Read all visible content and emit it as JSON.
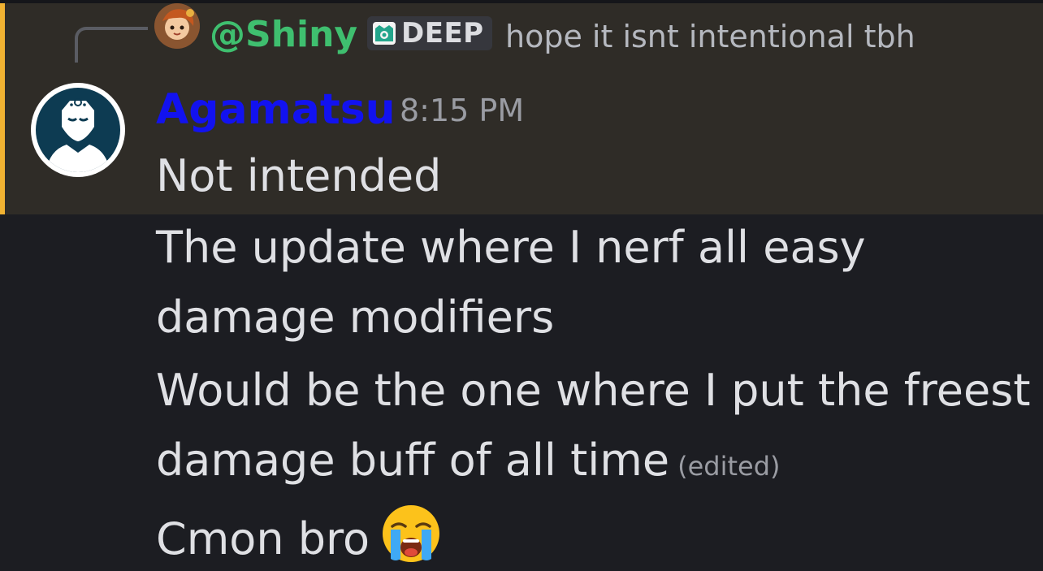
{
  "reply": {
    "username": "@Shiny",
    "role_tag": "DEEP",
    "text": "hope it isnt intentional tbh",
    "avatar_icon": "character-avatar-icon",
    "name_color": "#3fbf6f"
  },
  "message": {
    "author": "Agamatsu",
    "author_color": "#1212f0",
    "timestamp": "8:15 PM",
    "avatar_icon": "default-user-avatar-icon",
    "lines": [
      "Not intended",
      "The update where I nerf all easy",
      "damage modifiers",
      "Would be the one where I put the freest",
      "damage buff of all time",
      "Cmon bro"
    ],
    "edited_label": "(edited)",
    "final_emoji": "loudly-crying-face-emoji"
  },
  "colors": {
    "background": "#1c1d22",
    "mention_highlight": "#2f2c27",
    "mention_accent": "#f0b232"
  }
}
